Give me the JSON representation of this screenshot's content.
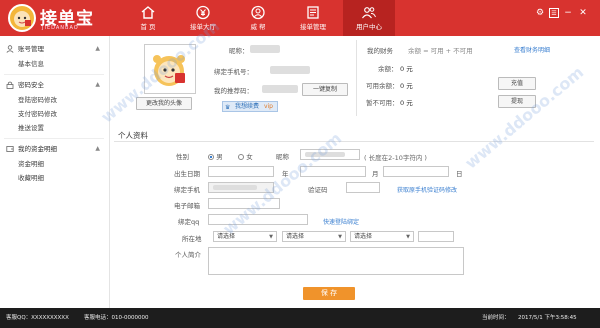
{
  "app": {
    "logo_text": "接单宝",
    "logo_sub": "JIEDANBAO"
  },
  "nav": [
    {
      "label": "首 页",
      "icon": "home-icon"
    },
    {
      "label": "接单大厅",
      "icon": "yen-icon"
    },
    {
      "label": "威 帮",
      "icon": "user-circle-icon"
    },
    {
      "label": "接单管理",
      "icon": "document-icon"
    },
    {
      "label": "用户中心",
      "icon": "users-icon"
    }
  ],
  "window_controls": {
    "settings": "⚙",
    "menu": "☰",
    "minimize": "−",
    "close": "✕"
  },
  "sidebar": {
    "groups": [
      {
        "label": "账号管理",
        "items": [
          "基本信息"
        ]
      },
      {
        "label": "密码安全",
        "items": [
          "登陆密码修改",
          "支付密码修改",
          "推送设置"
        ]
      },
      {
        "label": "我的资金明细",
        "items": [
          "资金明细",
          "收藏明细"
        ]
      }
    ]
  },
  "profile": {
    "change_avatar": "更改我的头像",
    "nickname_label": "昵称：",
    "phone_label": "绑定手机号：",
    "referral_label": "我的推荐码：",
    "copy_button": "一键复制",
    "vip_button": "我想续费",
    "vip_tag": "vip"
  },
  "finance": {
    "title": "我的财务",
    "legend": "余额 = 可用 + 不可用",
    "detail_link": "查看财务明细",
    "balance_label": "余额：",
    "balance_value": "0 元",
    "available_label": "可用余额：",
    "available_value": "0 元",
    "frozen_label": "暂不可用：",
    "frozen_value": "0 元",
    "recharge_button": "充值",
    "withdraw_button": "提现"
  },
  "personal": {
    "section_title": "个人资料",
    "gender_label": "性别",
    "gender_male": "男",
    "gender_female": "女",
    "nickname_label": "昵称",
    "nickname_hint": "( 长度在2-10字符内 )",
    "birthday_label": "出生日期",
    "year": "年",
    "month": "月",
    "day": "日",
    "phone_label": "绑定手机",
    "code_label": "验证码",
    "code_link": "获取原手机验证码修改",
    "email_label": "电子邮箱",
    "qq_label": "绑定qq",
    "qq_link": "快速登陆绑定",
    "location_label": "所在地",
    "select_placeholder": "请选择",
    "intro_label": "个人简介",
    "save_button": "保 存"
  },
  "footer": {
    "qq": "客服QQ：XXXXXXXXXX",
    "phone": "客服电话：010-0000000",
    "time_label": "当前时间：",
    "time_value": "2017/5/1 下午3:58:45"
  },
  "watermark": "www.ddooo.com"
}
